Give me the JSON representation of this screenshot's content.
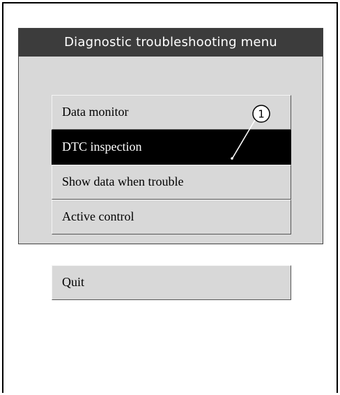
{
  "panel": {
    "title": "Diagnostic troubleshooting menu"
  },
  "menu": {
    "items": [
      {
        "label": "Data monitor",
        "selected": false
      },
      {
        "label": "DTC inspection",
        "selected": true
      },
      {
        "label": "Show data when trouble",
        "selected": false
      },
      {
        "label": "Active control",
        "selected": false
      }
    ],
    "quit_label": "Quit"
  },
  "callout": {
    "number": "1"
  },
  "colors": {
    "panel_bg": "#d8d8d8",
    "title_bg": "#3c3c3c",
    "selected_bg": "#000000"
  }
}
